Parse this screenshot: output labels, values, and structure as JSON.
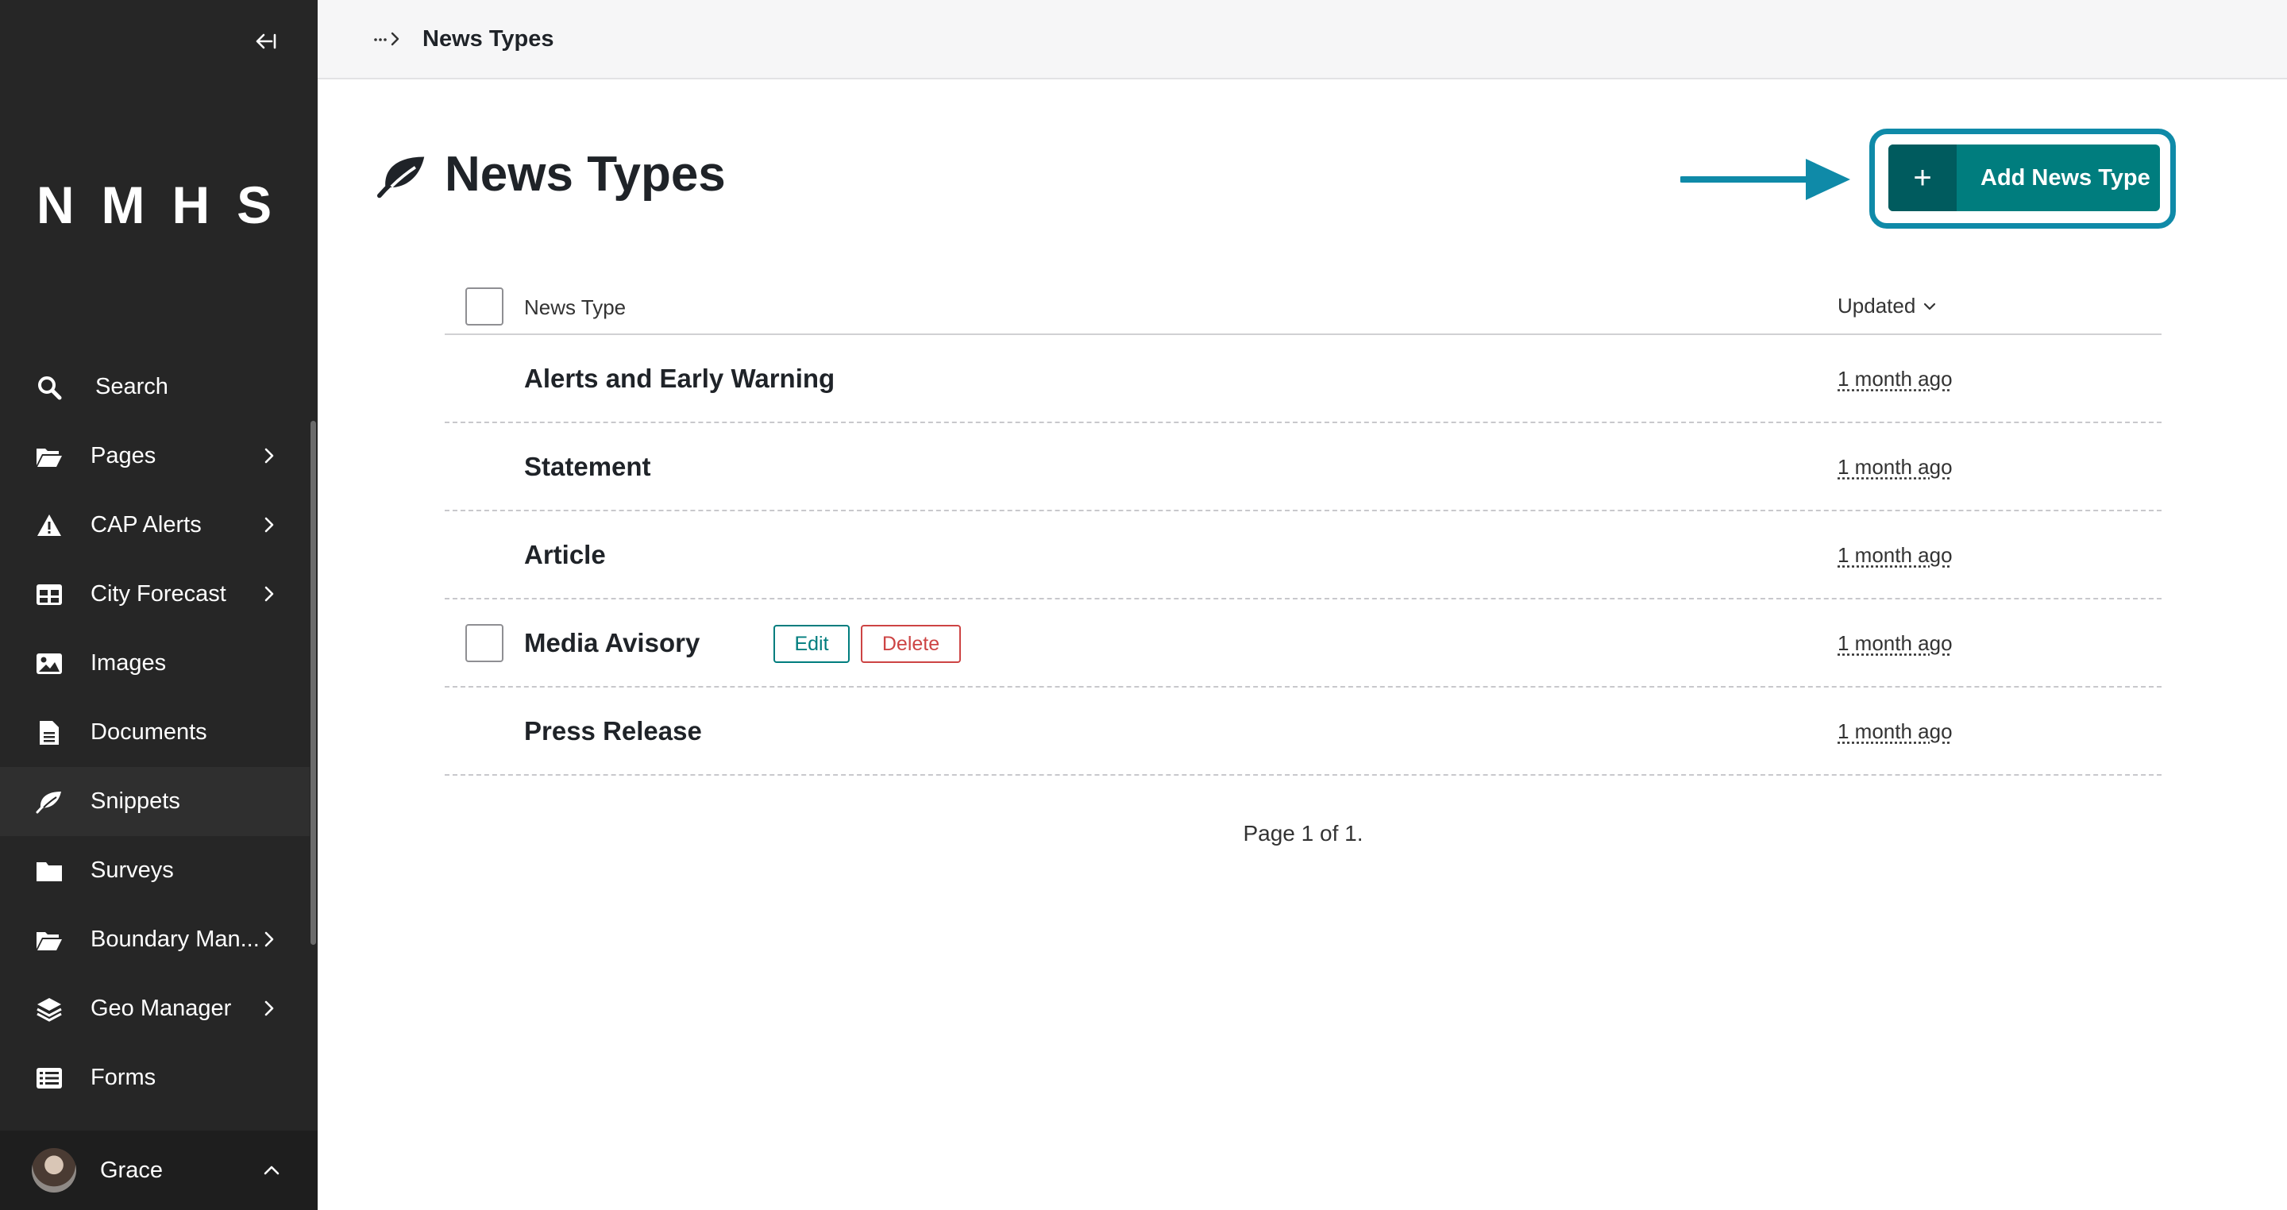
{
  "sidebar": {
    "logo": "NMHS",
    "collapse_icon": "collapse-left-icon",
    "items": [
      {
        "label": "Search",
        "icon": "search-icon",
        "has_submenu": false
      },
      {
        "label": "Pages",
        "icon": "folder-open-icon",
        "has_submenu": true
      },
      {
        "label": "CAP Alerts",
        "icon": "warning-icon",
        "has_submenu": true
      },
      {
        "label": "City Forecast",
        "icon": "table-icon",
        "has_submenu": true
      },
      {
        "label": "Images",
        "icon": "image-icon",
        "has_submenu": false
      },
      {
        "label": "Documents",
        "icon": "document-icon",
        "has_submenu": false
      },
      {
        "label": "Snippets",
        "icon": "snippet-icon",
        "has_submenu": false,
        "active": true
      },
      {
        "label": "Surveys",
        "icon": "folder-icon",
        "has_submenu": false
      },
      {
        "label": "Boundary Man...",
        "icon": "folder-open-icon",
        "has_submenu": true
      },
      {
        "label": "Geo Manager",
        "icon": "layers-icon",
        "has_submenu": true
      },
      {
        "label": "Forms",
        "icon": "list-icon",
        "has_submenu": false
      }
    ],
    "user": {
      "name": "Grace"
    }
  },
  "header": {
    "breadcrumb_current": "News Types"
  },
  "page": {
    "title": "News Types",
    "add_button_label": "Add News Type"
  },
  "table": {
    "columns": {
      "name": "News Type",
      "updated": "Updated"
    },
    "rows": [
      {
        "title": "Alerts and Early Warning",
        "updated": "1 month ago"
      },
      {
        "title": "Statement",
        "updated": "1 month ago"
      },
      {
        "title": "Article",
        "updated": "1 month ago"
      },
      {
        "title": "Media Avisory",
        "updated": "1 month ago",
        "hovered": true,
        "edit_label": "Edit",
        "delete_label": "Delete"
      },
      {
        "title": "Press Release",
        "updated": "1 month ago"
      }
    ]
  },
  "pagination": {
    "text": "Page 1 of 1."
  },
  "colors": {
    "sidebar_bg": "#262626",
    "primary": "#007d7e",
    "primary_dark": "#005b5e",
    "highlight": "#0f8aa8",
    "danger": "#cd4444"
  }
}
